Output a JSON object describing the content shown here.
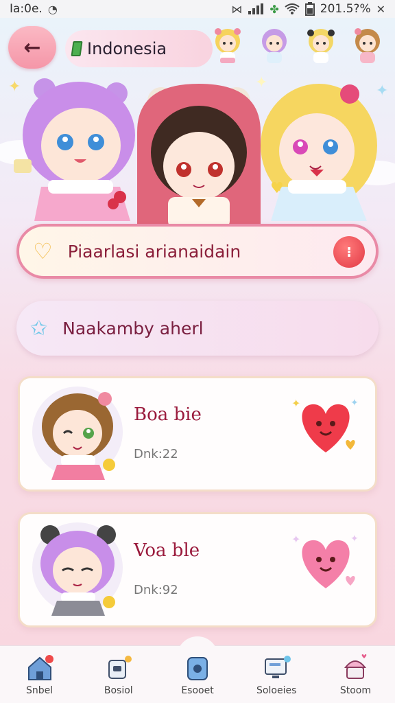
{
  "status_bar": {
    "time": "Ia:0e.",
    "right_text": "201.5?%",
    "icons": [
      "vibrate-icon",
      "signal-icon",
      "clover-icon",
      "wifi-icon",
      "battery-icon"
    ]
  },
  "header": {
    "country_label": "Indonesia"
  },
  "promo_card": {
    "text": "Piaarlasi arianaidain"
  },
  "secondary_card": {
    "text": "Naakamby aherl"
  },
  "list": [
    {
      "title": "Boa bie",
      "subtitle": "Dnk:22",
      "heart_color": "#ef3b4a"
    },
    {
      "title": "Voa ble",
      "subtitle": "Dnk:92",
      "heart_color": "#f47fa8"
    }
  ],
  "bottom_nav": [
    {
      "label": "Snbel",
      "icon": "home-icon",
      "badge": "#ef4a4a"
    },
    {
      "label": "Bosiol",
      "icon": "cup-icon",
      "badge": "#f5b942"
    },
    {
      "label": "Esooet",
      "icon": "bag-icon",
      "badge": ""
    },
    {
      "label": "Soloeies",
      "icon": "monitor-icon",
      "badge": "#6fc4ea"
    },
    {
      "label": "Stoom",
      "icon": "cupcake-icon",
      "badge": ""
    }
  ],
  "colors": {
    "accent": "#e98aa6",
    "title_red": "#9a1a3c",
    "back_button": "#f596a8"
  }
}
